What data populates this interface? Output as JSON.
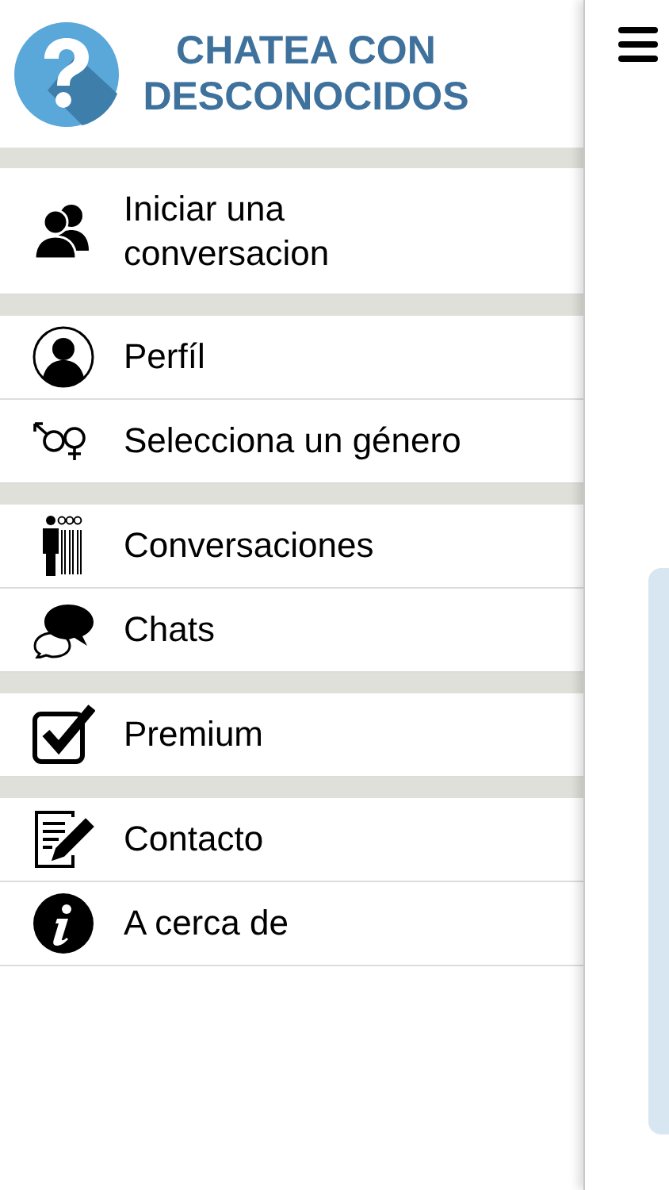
{
  "header": {
    "title": "CHATEA CON DESCONOCIDOS"
  },
  "sections": [
    {
      "items": [
        {
          "label": "Iniciar una conversacion"
        }
      ]
    },
    {
      "items": [
        {
          "label": "Perfíl"
        },
        {
          "label": "Selecciona un género"
        }
      ]
    },
    {
      "items": [
        {
          "label": "Conversaciones"
        },
        {
          "label": "Chats"
        }
      ]
    },
    {
      "items": [
        {
          "label": "Premium"
        }
      ]
    },
    {
      "items": [
        {
          "label": "Contacto"
        },
        {
          "label": "A cerca de"
        }
      ]
    }
  ]
}
